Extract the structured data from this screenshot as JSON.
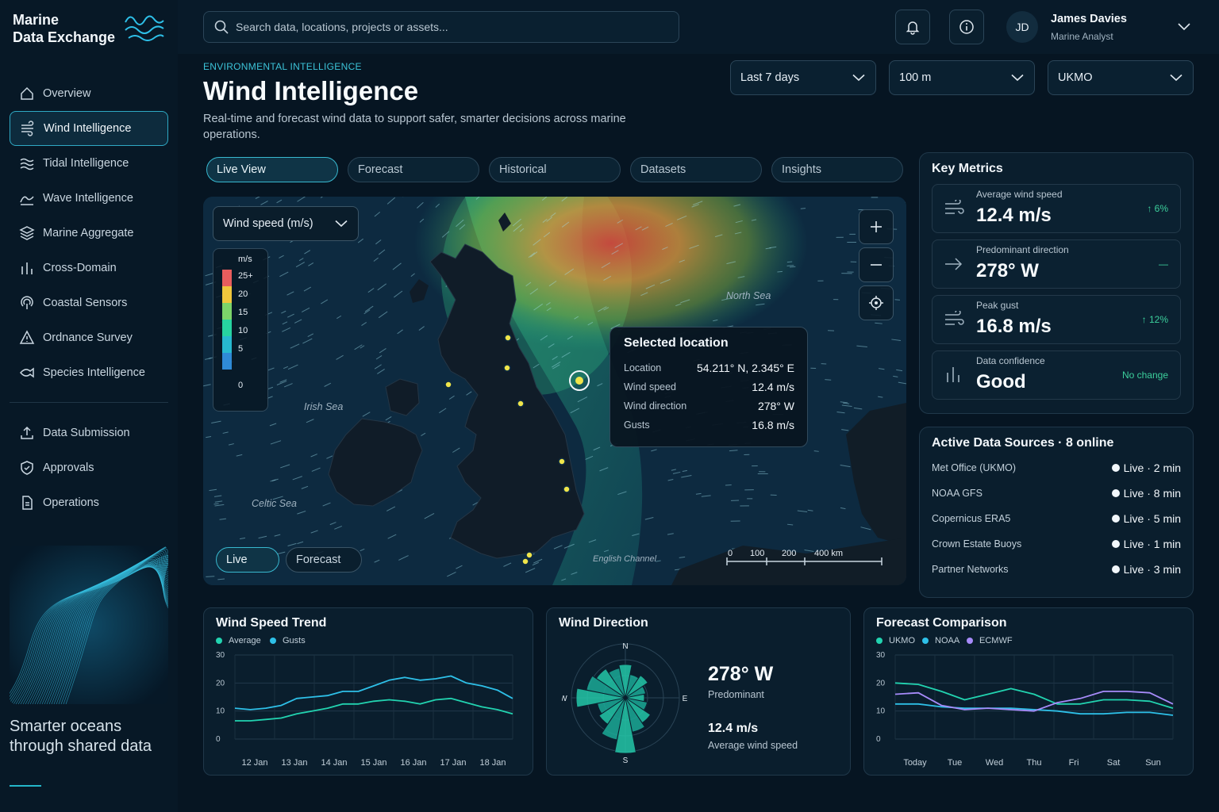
{
  "brand": {
    "line1": "Marine",
    "line2": "Data Exchange"
  },
  "search": {
    "placeholder": "Search data, locations, projects or assets..."
  },
  "user": {
    "initials": "JD",
    "name": "James Davies",
    "role": "Marine Analyst"
  },
  "nav": {
    "primary": [
      "Overview",
      "Wind Intelligence",
      "Tidal Intelligence",
      "Wave Intelligence",
      "Marine Aggregate",
      "Cross-Domain",
      "Coastal Sensors",
      "Ordnance Survey",
      "Species Intelligence"
    ],
    "secondary": [
      "Data Submission",
      "Approvals",
      "Operations"
    ],
    "active": "Wind Intelligence"
  },
  "tagline": "Smarter oceans through shared data",
  "header": {
    "eyebrow": "ENVIRONMENTAL INTELLIGENCE",
    "title": "Wind Intelligence",
    "subtitle": "Real-time and forecast wind data to support safer, smarter decisions across marine operations."
  },
  "filters": {
    "period": "Last 7 days",
    "height": "100 m",
    "source": "UKMO"
  },
  "tabs": [
    "Live View",
    "Forecast",
    "Historical",
    "Datasets",
    "Insights"
  ],
  "map": {
    "layer_select": "Wind speed (m/s)",
    "legend": {
      "unit": "m/s",
      "labels": [
        "25+",
        "20",
        "15",
        "10",
        "5",
        "0"
      ]
    },
    "seas": {
      "north": "North Sea",
      "irish": "Irish Sea",
      "celtic": "Celtic Sea",
      "channel": "English Channel"
    },
    "modes": [
      "Live",
      "Forecast"
    ],
    "scale": [
      "0",
      "100",
      "200",
      "400 km"
    ],
    "tooltip": {
      "title": "Selected location",
      "rows": [
        {
          "key": "Location",
          "value": "54.211° N, 2.345° E"
        },
        {
          "key": "Wind speed",
          "value": "12.4 m/s"
        },
        {
          "key": "Wind direction",
          "value": "278° W"
        },
        {
          "key": "Gusts",
          "value": "16.8 m/s"
        }
      ]
    }
  },
  "metrics": {
    "title": "Key Metrics",
    "items": [
      {
        "label": "Average wind speed",
        "value": "12.4 m/s",
        "delta": "↑ 6%"
      },
      {
        "label": "Predominant direction",
        "value": "278° W",
        "delta": "—"
      },
      {
        "label": "Peak gust",
        "value": "16.8 m/s",
        "delta": "↑ 12%"
      },
      {
        "label": "Data confidence",
        "value": "Good",
        "delta": "No change"
      }
    ]
  },
  "sources": {
    "title": "Active Data Sources · 8 online",
    "items": [
      {
        "name": "Met Office (UKMO)",
        "status": "Live · 2 min"
      },
      {
        "name": "NOAA GFS",
        "status": "Live · 8 min"
      },
      {
        "name": "Copernicus ERA5",
        "status": "Live · 5 min"
      },
      {
        "name": "Crown Estate Buoys",
        "status": "Live · 1 min"
      },
      {
        "name": "Partner Networks",
        "status": "Live · 3 min"
      }
    ]
  },
  "wind_direction": {
    "title": "Wind Direction",
    "compass": [
      "N",
      "E",
      "S",
      "W"
    ],
    "direction": "278° W",
    "direction_label": "Predominant",
    "speed": "12.4 m/s",
    "speed_label": "Average wind speed"
  },
  "chart_data": [
    {
      "type": "line",
      "title": "Wind Speed Trend",
      "categories": [
        "12 Jan",
        "13 Jan",
        "14 Jan",
        "15 Jan",
        "16 Jan",
        "17 Jan",
        "18 Jan"
      ],
      "ylim": [
        0,
        30
      ],
      "yticks": [
        0,
        10,
        20,
        30
      ],
      "series": [
        {
          "name": "Average",
          "color": "#22d3b0",
          "values": [
            6.5,
            6.5,
            7,
            7.5,
            9,
            10,
            11,
            12.5,
            12.5,
            13.5,
            14,
            13.5,
            12.5,
            14,
            14.5,
            13,
            11.5,
            10.5,
            9
          ]
        },
        {
          "name": "Gusts",
          "color": "#2ec0e8",
          "values": [
            11,
            10.5,
            11,
            12,
            14.5,
            15,
            15.5,
            17,
            17,
            19,
            21,
            22,
            21,
            21.5,
            22.5,
            20,
            19,
            17.5,
            14.5
          ]
        }
      ]
    },
    {
      "type": "line",
      "title": "Forecast Comparison",
      "categories": [
        "Today",
        "Tue",
        "Wed",
        "Thu",
        "Fri",
        "Sat",
        "Sun"
      ],
      "ylim": [
        0,
        30
      ],
      "yticks": [
        0,
        10,
        20,
        30
      ],
      "series": [
        {
          "name": "UKMO",
          "color": "#22d3b0",
          "values": [
            20,
            19.5,
            17,
            14,
            16,
            18,
            16,
            12.5,
            12.5,
            14,
            14,
            13.5,
            11
          ]
        },
        {
          "name": "NOAA",
          "color": "#2ec0e8",
          "values": [
            12.5,
            12.5,
            11.5,
            11,
            11,
            11,
            10.5,
            10,
            9,
            9,
            9.5,
            9.5,
            8.5
          ]
        },
        {
          "name": "ECMWF",
          "color": "#a78bfa",
          "values": [
            16,
            16.5,
            12,
            10.5,
            11,
            10.5,
            10,
            13,
            14.5,
            17,
            17,
            16.5,
            12.5
          ]
        }
      ]
    }
  ]
}
